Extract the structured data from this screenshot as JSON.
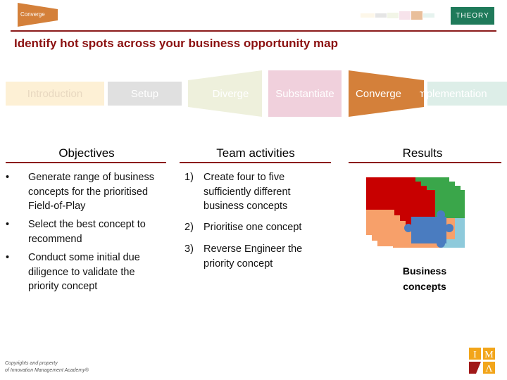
{
  "header": {
    "badge": "Converge",
    "theory": "THEORY",
    "title": "Identify hot spots across your business opportunity map"
  },
  "phases": [
    "Introduction",
    "Setup",
    "Diverge",
    "Substantiate",
    "Converge",
    "Implementation"
  ],
  "colors": {
    "accent": "#d4803a",
    "title": "#8b1010",
    "theory": "#1f7a5a"
  },
  "objectives": {
    "heading": "Objectives",
    "items": [
      "Generate range of business concepts for the prioritised Field-of-Play",
      "Select the best concept to recommend",
      "Conduct some initial due diligence to validate the priority concept"
    ]
  },
  "activities": {
    "heading": "Team activities",
    "items": [
      {
        "n": "1)",
        "t": "Create four to five sufficiently different business concepts"
      },
      {
        "n": "2)",
        "t": "Prioritise one concept"
      },
      {
        "n": "3)",
        "t": "Reverse Engineer the priority concept"
      }
    ]
  },
  "results": {
    "heading": "Results",
    "caption": "Business concepts"
  },
  "footer": {
    "line1": "Copyrights and property",
    "line2": "of Innovation Management Academy®"
  },
  "logo": "IMA"
}
